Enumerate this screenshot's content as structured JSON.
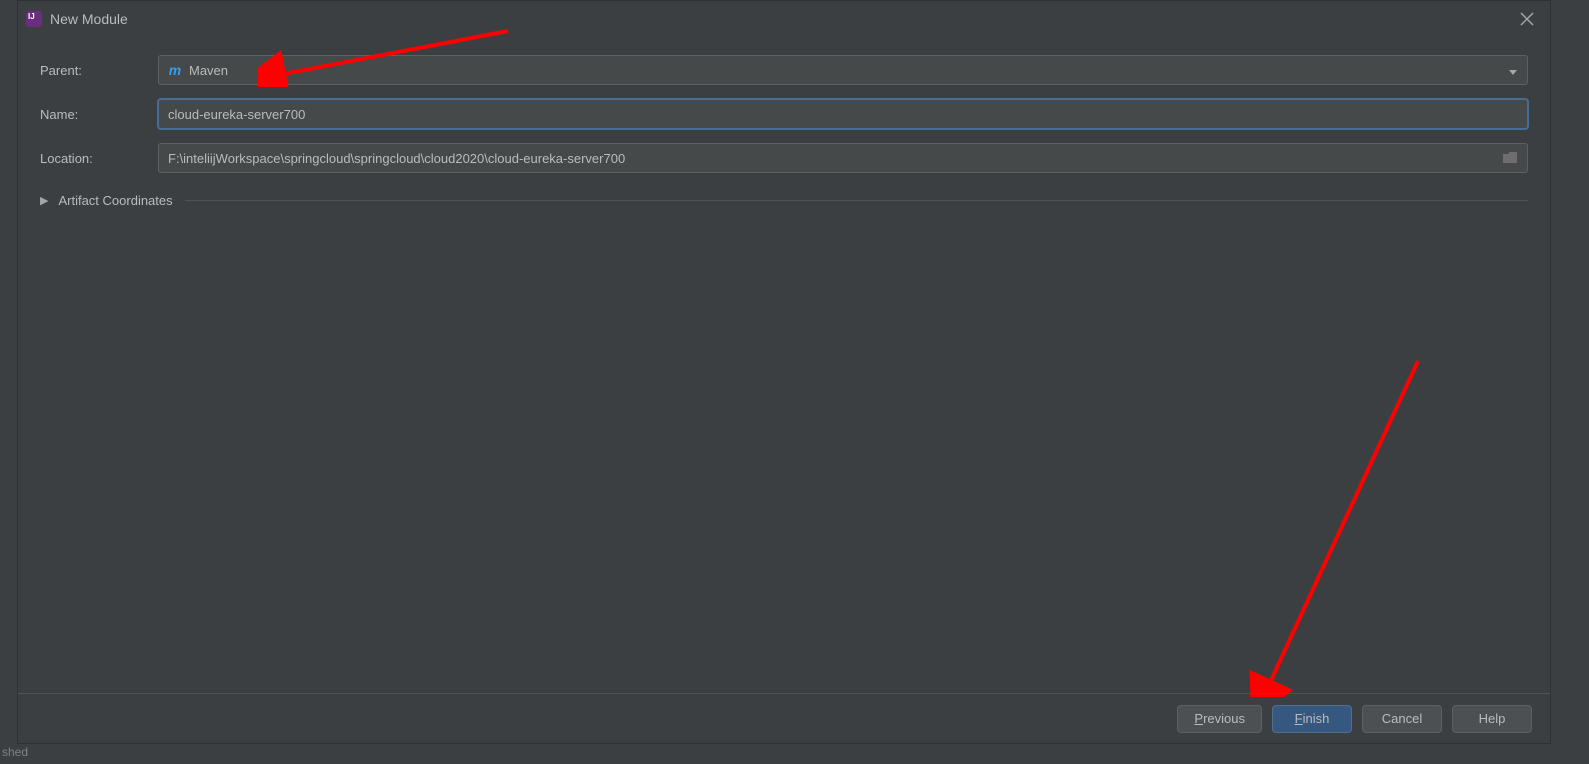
{
  "dialog": {
    "title": "New Module",
    "labels": {
      "parent": "Parent:",
      "name": "Name:",
      "location": "Location:"
    },
    "parent_value": "Maven",
    "name_value": "cloud-eureka-server700",
    "location_value": "F:\\inteliijWorkspace\\springcloud\\springcloud\\cloud2020\\cloud-eureka-server700",
    "artifact_section": "Artifact Coordinates",
    "buttons": {
      "previous": "Previous",
      "finish": "Finish",
      "cancel": "Cancel",
      "help": "Help"
    }
  },
  "footer": "shed"
}
